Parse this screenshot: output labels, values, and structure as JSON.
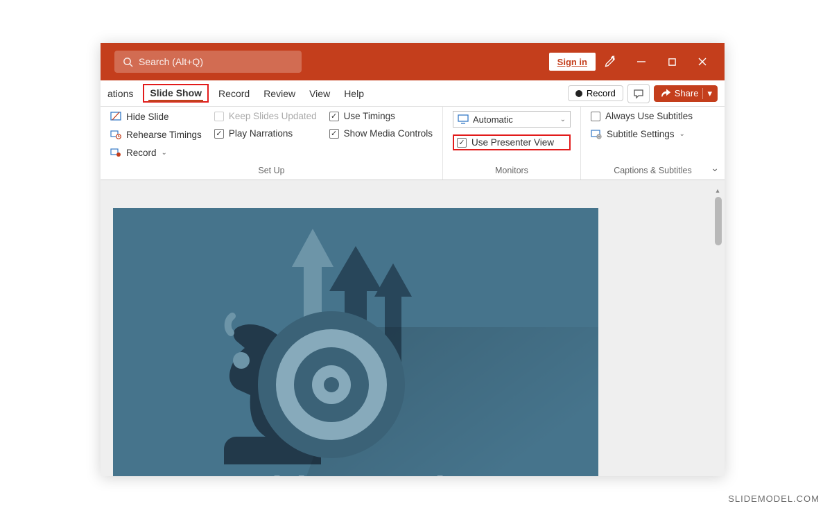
{
  "titlebar": {
    "search_placeholder": "Search (Alt+Q)",
    "signin": "Sign in"
  },
  "tabs": {
    "cut_off": "ations",
    "active": "Slide Show",
    "items": [
      "Record",
      "Review",
      "View",
      "Help"
    ],
    "record_btn": "Record",
    "share_btn": "Share"
  },
  "ribbon": {
    "setup": {
      "hide_slide": "Hide Slide",
      "rehearse_timings": "Rehearse Timings",
      "record": "Record",
      "keep_slides_updated": "Keep Slides Updated",
      "play_narrations": "Play Narrations",
      "use_timings": "Use Timings",
      "show_media_controls": "Show Media Controls",
      "group_label": "Set Up"
    },
    "monitors": {
      "dropdown_value": "Automatic",
      "use_presenter_view": "Use Presenter View",
      "group_label": "Monitors"
    },
    "captions": {
      "always_use_subtitles": "Always Use Subtitles",
      "subtitle_settings": "Subtitle Settings",
      "group_label": "Captions & Subtitles"
    }
  },
  "slide": {
    "title": "Hoshin Kanri"
  },
  "watermark": "SLIDEMODEL.COM"
}
